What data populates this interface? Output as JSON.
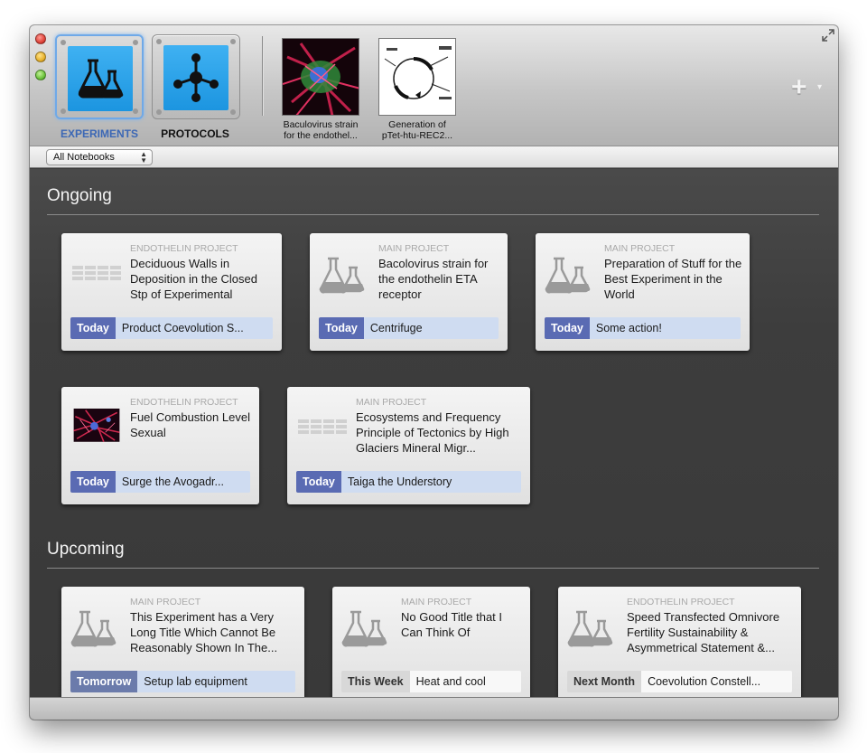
{
  "toolbar": {
    "experiments_label": "EXPERIMENTS",
    "protocols_label": "PROTOCOLS",
    "recent": [
      {
        "label_line1": "Baculovirus strain",
        "label_line2": "for the endothel..."
      },
      {
        "label_line1": "Generation of",
        "label_line2": "pTet-htu-REC2..."
      }
    ],
    "add_glyph": "+",
    "add_chevron": "▾"
  },
  "filter": {
    "selected": "All Notebooks"
  },
  "sections": {
    "ongoing": "Ongoing",
    "upcoming": "Upcoming"
  },
  "ongoing_cards": [
    {
      "project": "ENDOTHELIN PROJECT",
      "title": "Deciduous Walls in Deposition in the Closed Stp of Experimental",
      "when": "Today",
      "action": "Product Coevolution S...",
      "icon": "table-icon"
    },
    {
      "project": "MAIN PROJECT",
      "title": "Bacolovirus strain for the endothelin ETA receptor",
      "when": "Today",
      "action": "Centrifuge",
      "icon": "flask-icon"
    },
    {
      "project": "MAIN PROJECT",
      "title": "Preparation of Stuff for the Best Experiment in the World",
      "when": "Today",
      "action": "Some action!",
      "icon": "flask-icon"
    },
    {
      "project": "ENDOTHELIN PROJECT",
      "title": "Fuel Combustion Level Sexual",
      "when": "Today",
      "action": "Surge the Avogadr...",
      "icon": "microscopy-image"
    },
    {
      "project": "MAIN PROJECT",
      "title": "Ecosystems and Frequency Principle of Tectonics by High Glaciers Mineral Migr...",
      "when": "Today",
      "action": "Taiga the Understory",
      "icon": "table-icon"
    }
  ],
  "upcoming_cards": [
    {
      "project": "MAIN PROJECT",
      "title": "This Experiment has a Very Long Title Which Cannot Be Reasonably Shown In The...",
      "when": "Tomorrow",
      "action": "Setup lab equipment",
      "icon": "flask-icon"
    },
    {
      "project": "MAIN PROJECT",
      "title": "No Good Title that I Can Think Of",
      "when": "This Week",
      "action": "Heat and cool",
      "icon": "flask-icon"
    },
    {
      "project": "ENDOTHELIN PROJECT",
      "title": "Speed Transfected Omnivore Fertility Sustainability & Asymmetrical Statement &...",
      "when": "Next Month",
      "action": "Coevolution Constell...",
      "icon": "flask-icon"
    }
  ],
  "colors": {
    "accent_blue": "#3b67b5",
    "today_tag": "#5a6bb3",
    "tile_blue": "#1c95e0"
  }
}
